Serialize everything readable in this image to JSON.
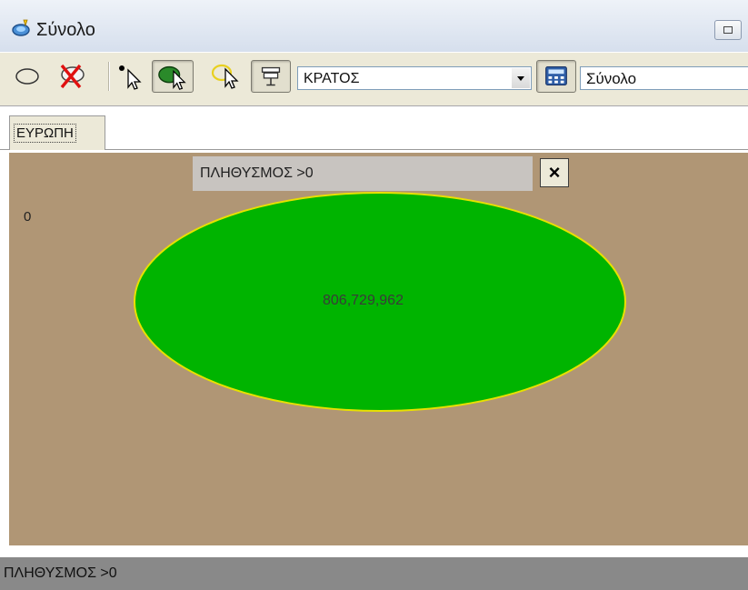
{
  "window": {
    "title": "Σύνολο"
  },
  "toolbar": {
    "icons": [
      "ellipse-select-icon",
      "clear-selection-icon",
      "point-select-icon",
      "region-select-icon",
      "cursor-select-icon",
      "presentation-icon",
      "calculator-icon"
    ],
    "level_combo": {
      "value": "ΚΡΑΤΟΣ"
    },
    "aggregate_field": {
      "value": "Σύνολο"
    }
  },
  "tabs": [
    {
      "label": "ΕΥΡΩΠΗ",
      "selected": true
    }
  ],
  "map": {
    "filter_label": "ΠΛΗΘΥΣΜΟΣ >0",
    "close_symbol": "×",
    "scale_min_label": "0",
    "region_value": "806,729,962",
    "background_color": "#b09675",
    "region_fill": "#00b400",
    "region_outline": "#e8e000"
  },
  "statusbar": {
    "text": "ΠΛΗΘΥΣΜΟΣ >0"
  }
}
